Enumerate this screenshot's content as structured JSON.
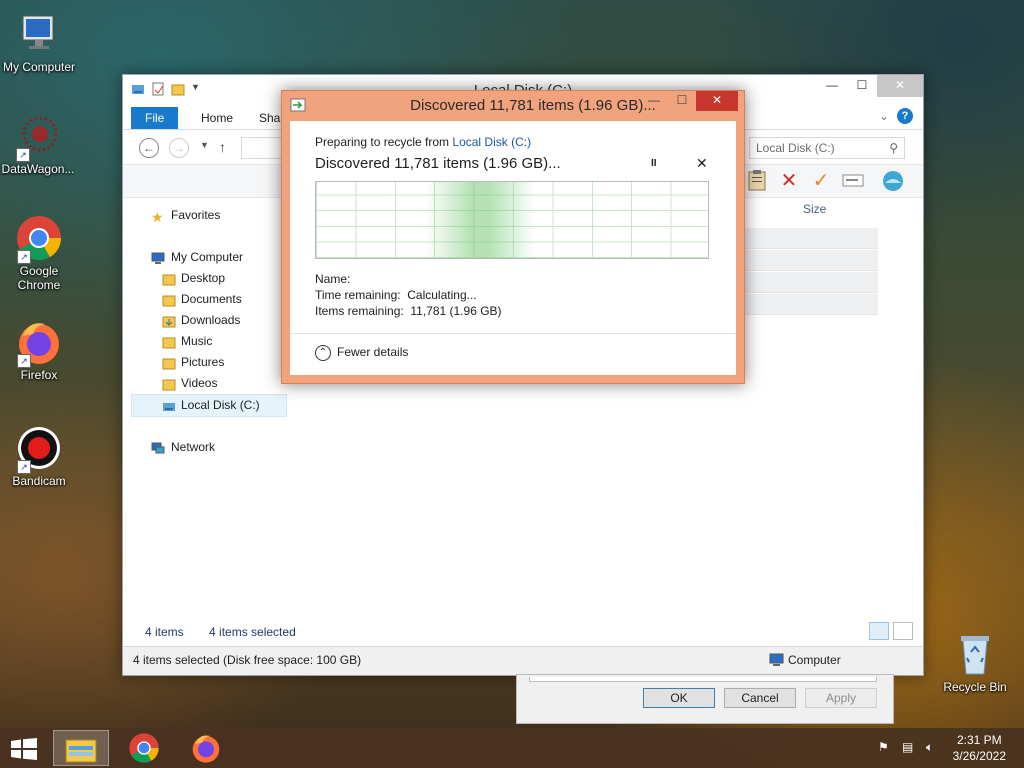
{
  "desktop": {
    "icons": [
      {
        "label": "My Computer"
      },
      {
        "label": "DataWagon..."
      },
      {
        "label": "Google Chrome"
      },
      {
        "label": "Firefox"
      },
      {
        "label": "Bandicam"
      },
      {
        "label": "Recycle Bin"
      }
    ]
  },
  "explorer": {
    "title": "Local Disk (C:)",
    "tabs": {
      "file": "File",
      "home": "Home",
      "share": "Shar"
    },
    "search_placeholder": "Local Disk (C:)",
    "column_size": "Size",
    "nav": {
      "favorites": "Favorites",
      "my_computer": "My Computer",
      "desktop": "Desktop",
      "documents": "Documents",
      "downloads": "Downloads",
      "music": "Music",
      "pictures": "Pictures",
      "videos": "Videos",
      "local_disk": "Local Disk (C:)",
      "network": "Network"
    },
    "status_items": "4 items",
    "status_selected": "4 items selected",
    "statusbar_text": "4 items selected (Disk free space: 100 GB)",
    "statusbar_location": "Computer"
  },
  "progress_dialog": {
    "title": "Discovered 11,781 items (1.96 GB)...",
    "preparing_prefix": "Preparing to recycle from ",
    "preparing_link": "Local Disk (C:)",
    "heading": "Discovered 11,781 items (1.96 GB)...",
    "pause_glyph": "II",
    "stop_glyph": "✕",
    "name_label": "Name:",
    "time_remaining": "Time remaining:  Calculating...",
    "items_remaining": "Items remaining:  11,781 (1.96 GB)",
    "fewer_details": "Fewer details"
  },
  "properties_dialog": {
    "ok": "OK",
    "cancel": "Cancel",
    "apply": "Apply"
  },
  "taskbar": {
    "time": "2:31 PM",
    "date": "3/26/2022"
  },
  "colors": {
    "dialog_frame": "#f0a37c",
    "ribbon_file": "#1979ca",
    "close_red": "#c8352d"
  }
}
